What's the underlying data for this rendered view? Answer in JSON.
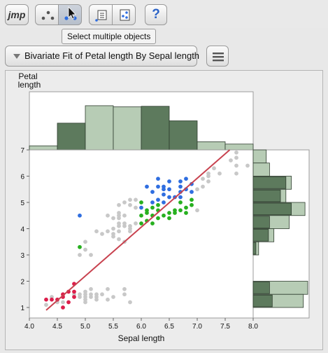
{
  "toolbar": {
    "logo": "jmp",
    "buttons": [
      {
        "name": "select-single-object",
        "pressed": false
      },
      {
        "name": "select-multiple-objects",
        "pressed": true
      },
      {
        "name": "report-view",
        "pressed": false
      },
      {
        "name": "data-view",
        "pressed": false
      },
      {
        "name": "help",
        "label": "?"
      }
    ],
    "tooltip": "Select multiple objects"
  },
  "report": {
    "title": "Bivariate Fit of Petal length By Sepal length"
  },
  "chart_data": {
    "type": "scatter",
    "xlabel": "Sepal length",
    "ylabel": "Petal length",
    "xlim": [
      4.0,
      8.0
    ],
    "ylim": [
      0.6,
      7.0
    ],
    "xticks": [
      "4.0",
      "4.5",
      "5.0",
      "5.5",
      "6.0",
      "6.5",
      "7.0",
      "7.5",
      "8.0"
    ],
    "yticks": [
      "1",
      "2",
      "3",
      "4",
      "5",
      "6",
      "7"
    ],
    "colors": {
      "red": "#dc1e4b",
      "blue": "#2f6ee0",
      "green": "#27b01f",
      "grey": "#c8c8c8",
      "fit": "#c8424f",
      "hist_dark": "#5d7a5d",
      "hist_light": "#b7ccb5"
    },
    "fit_line": {
      "slope": 1.86,
      "intercept": -7.1
    },
    "series": [
      {
        "name": "red",
        "points": [
          [
            4.4,
            1.3
          ],
          [
            4.5,
            1.3
          ],
          [
            4.6,
            1.0
          ],
          [
            4.6,
            1.4
          ],
          [
            4.6,
            1.5
          ],
          [
            4.7,
            1.6
          ],
          [
            4.7,
            1.2
          ],
          [
            4.8,
            1.4
          ],
          [
            4.8,
            1.6
          ],
          [
            4.8,
            1.9
          ],
          [
            4.3,
            1.3
          ]
        ]
      },
      {
        "name": "blue",
        "points": [
          [
            4.9,
            4.5
          ],
          [
            6.0,
            4.8
          ],
          [
            6.1,
            5.6
          ],
          [
            6.2,
            5.4
          ],
          [
            6.2,
            5.0
          ],
          [
            6.3,
            5.9
          ],
          [
            6.3,
            5.6
          ],
          [
            6.3,
            5.1
          ],
          [
            6.4,
            5.6
          ],
          [
            6.4,
            5.3
          ],
          [
            6.4,
            5.0
          ],
          [
            6.5,
            5.8
          ],
          [
            6.5,
            5.5
          ],
          [
            6.5,
            5.2
          ],
          [
            6.6,
            5.2
          ],
          [
            6.7,
            5.8
          ],
          [
            6.7,
            5.6
          ],
          [
            6.7,
            5.2
          ],
          [
            6.8,
            5.9
          ],
          [
            6.8,
            5.5
          ],
          [
            6.9,
            5.7
          ],
          [
            6.9,
            5.4
          ],
          [
            6.7,
            5.4
          ],
          [
            6.4,
            5.5
          ]
        ]
      },
      {
        "name": "green",
        "points": [
          [
            4.9,
            3.3
          ],
          [
            6.0,
            5.0
          ],
          [
            6.0,
            4.5
          ],
          [
            6.1,
            4.6
          ],
          [
            6.1,
            4.3
          ],
          [
            6.2,
            4.5
          ],
          [
            6.3,
            4.9
          ],
          [
            6.3,
            4.4
          ],
          [
            6.4,
            4.5
          ],
          [
            6.5,
            4.6
          ],
          [
            6.6,
            4.7
          ],
          [
            6.7,
            4.7
          ],
          [
            6.8,
            4.8
          ],
          [
            6.9,
            4.9
          ],
          [
            6.0,
            4.2
          ],
          [
            6.1,
            4.7
          ],
          [
            6.2,
            4.8
          ],
          [
            6.3,
            4.7
          ],
          [
            6.5,
            4.4
          ],
          [
            6.6,
            4.6
          ],
          [
            6.7,
            5.0
          ],
          [
            6.9,
            5.1
          ],
          [
            6.8,
            4.6
          ],
          [
            6.2,
            4.2
          ]
        ]
      },
      {
        "name": "grey",
        "points": [
          [
            4.3,
            1.1
          ],
          [
            4.4,
            1.4
          ],
          [
            4.5,
            1.2
          ],
          [
            4.6,
            1.2
          ],
          [
            4.8,
            1.5
          ],
          [
            4.9,
            1.4
          ],
          [
            4.9,
            1.5
          ],
          [
            5.0,
            1.2
          ],
          [
            5.0,
            1.4
          ],
          [
            5.0,
            1.6
          ],
          [
            5.0,
            1.3
          ],
          [
            5.1,
            1.4
          ],
          [
            5.1,
            1.5
          ],
          [
            5.1,
            1.7
          ],
          [
            5.2,
            1.5
          ],
          [
            5.2,
            1.4
          ],
          [
            5.3,
            1.5
          ],
          [
            5.4,
            1.3
          ],
          [
            5.4,
            1.7
          ],
          [
            5.5,
            1.4
          ],
          [
            5.7,
            1.5
          ],
          [
            5.7,
            1.7
          ],
          [
            5.8,
            1.2
          ],
          [
            5.0,
            1.5
          ],
          [
            5.2,
            1.3
          ],
          [
            4.9,
            3.0
          ],
          [
            5.0,
            3.5
          ],
          [
            5.0,
            3.2
          ],
          [
            5.1,
            3.0
          ],
          [
            5.2,
            3.9
          ],
          [
            5.4,
            4.5
          ],
          [
            5.5,
            3.7
          ],
          [
            5.5,
            4.0
          ],
          [
            5.5,
            4.4
          ],
          [
            5.6,
            3.6
          ],
          [
            5.6,
            3.9
          ],
          [
            5.6,
            4.1
          ],
          [
            5.6,
            4.2
          ],
          [
            5.7,
            3.5
          ],
          [
            5.7,
            4.1
          ],
          [
            5.7,
            4.2
          ],
          [
            5.7,
            4.5
          ],
          [
            5.8,
            3.9
          ],
          [
            5.8,
            4.0
          ],
          [
            5.8,
            4.1
          ],
          [
            5.9,
            4.2
          ],
          [
            5.9,
            4.8
          ],
          [
            5.5,
            3.8
          ],
          [
            5.6,
            4.4
          ],
          [
            5.7,
            5.0
          ],
          [
            5.8,
            4.9
          ],
          [
            5.8,
            5.1
          ],
          [
            5.9,
            5.1
          ],
          [
            5.6,
            4.9
          ],
          [
            5.6,
            4.6
          ],
          [
            5.4,
            3.9
          ],
          [
            5.3,
            3.8
          ],
          [
            5.6,
            4.5
          ],
          [
            7.0,
            4.7
          ],
          [
            7.1,
            5.9
          ],
          [
            7.2,
            6.0
          ],
          [
            7.2,
            5.8
          ],
          [
            7.3,
            6.3
          ],
          [
            7.4,
            6.1
          ],
          [
            7.6,
            6.6
          ],
          [
            7.7,
            6.7
          ],
          [
            7.7,
            6.9
          ],
          [
            7.7,
            6.1
          ],
          [
            7.7,
            6.4
          ],
          [
            7.9,
            6.4
          ],
          [
            7.2,
            6.1
          ],
          [
            7.0,
            5.5
          ],
          [
            6.9,
            4.9
          ],
          [
            7.1,
            5.6
          ]
        ]
      }
    ],
    "top_histogram": {
      "bins": [
        [
          4.0,
          4.5,
          0.07
        ],
        [
          4.5,
          5.0,
          0.46
        ],
        [
          5.0,
          5.5,
          0.76
        ],
        [
          5.5,
          6.0,
          0.74
        ],
        [
          6.0,
          6.5,
          0.75
        ],
        [
          6.5,
          7.0,
          0.5
        ],
        [
          7.0,
          7.5,
          0.14
        ],
        [
          7.5,
          8.0,
          0.1
        ]
      ],
      "dark": [
        1,
        4,
        5
      ]
    },
    "right_histogram": {
      "bins": [
        [
          6.5,
          7.0,
          0.24,
          0.0
        ],
        [
          6.0,
          6.5,
          0.3,
          0.0
        ],
        [
          5.5,
          6.0,
          0.7,
          0.6
        ],
        [
          5.0,
          5.5,
          0.6,
          0.5
        ],
        [
          4.5,
          5.0,
          0.95,
          0.7
        ],
        [
          4.0,
          4.5,
          0.66,
          0.3
        ],
        [
          3.5,
          4.0,
          0.38,
          0.28
        ],
        [
          3.0,
          3.5,
          0.1,
          0.05
        ],
        [
          1.5,
          2.0,
          1.0,
          0.3
        ],
        [
          1.0,
          1.5,
          0.92,
          0.35
        ]
      ]
    }
  }
}
